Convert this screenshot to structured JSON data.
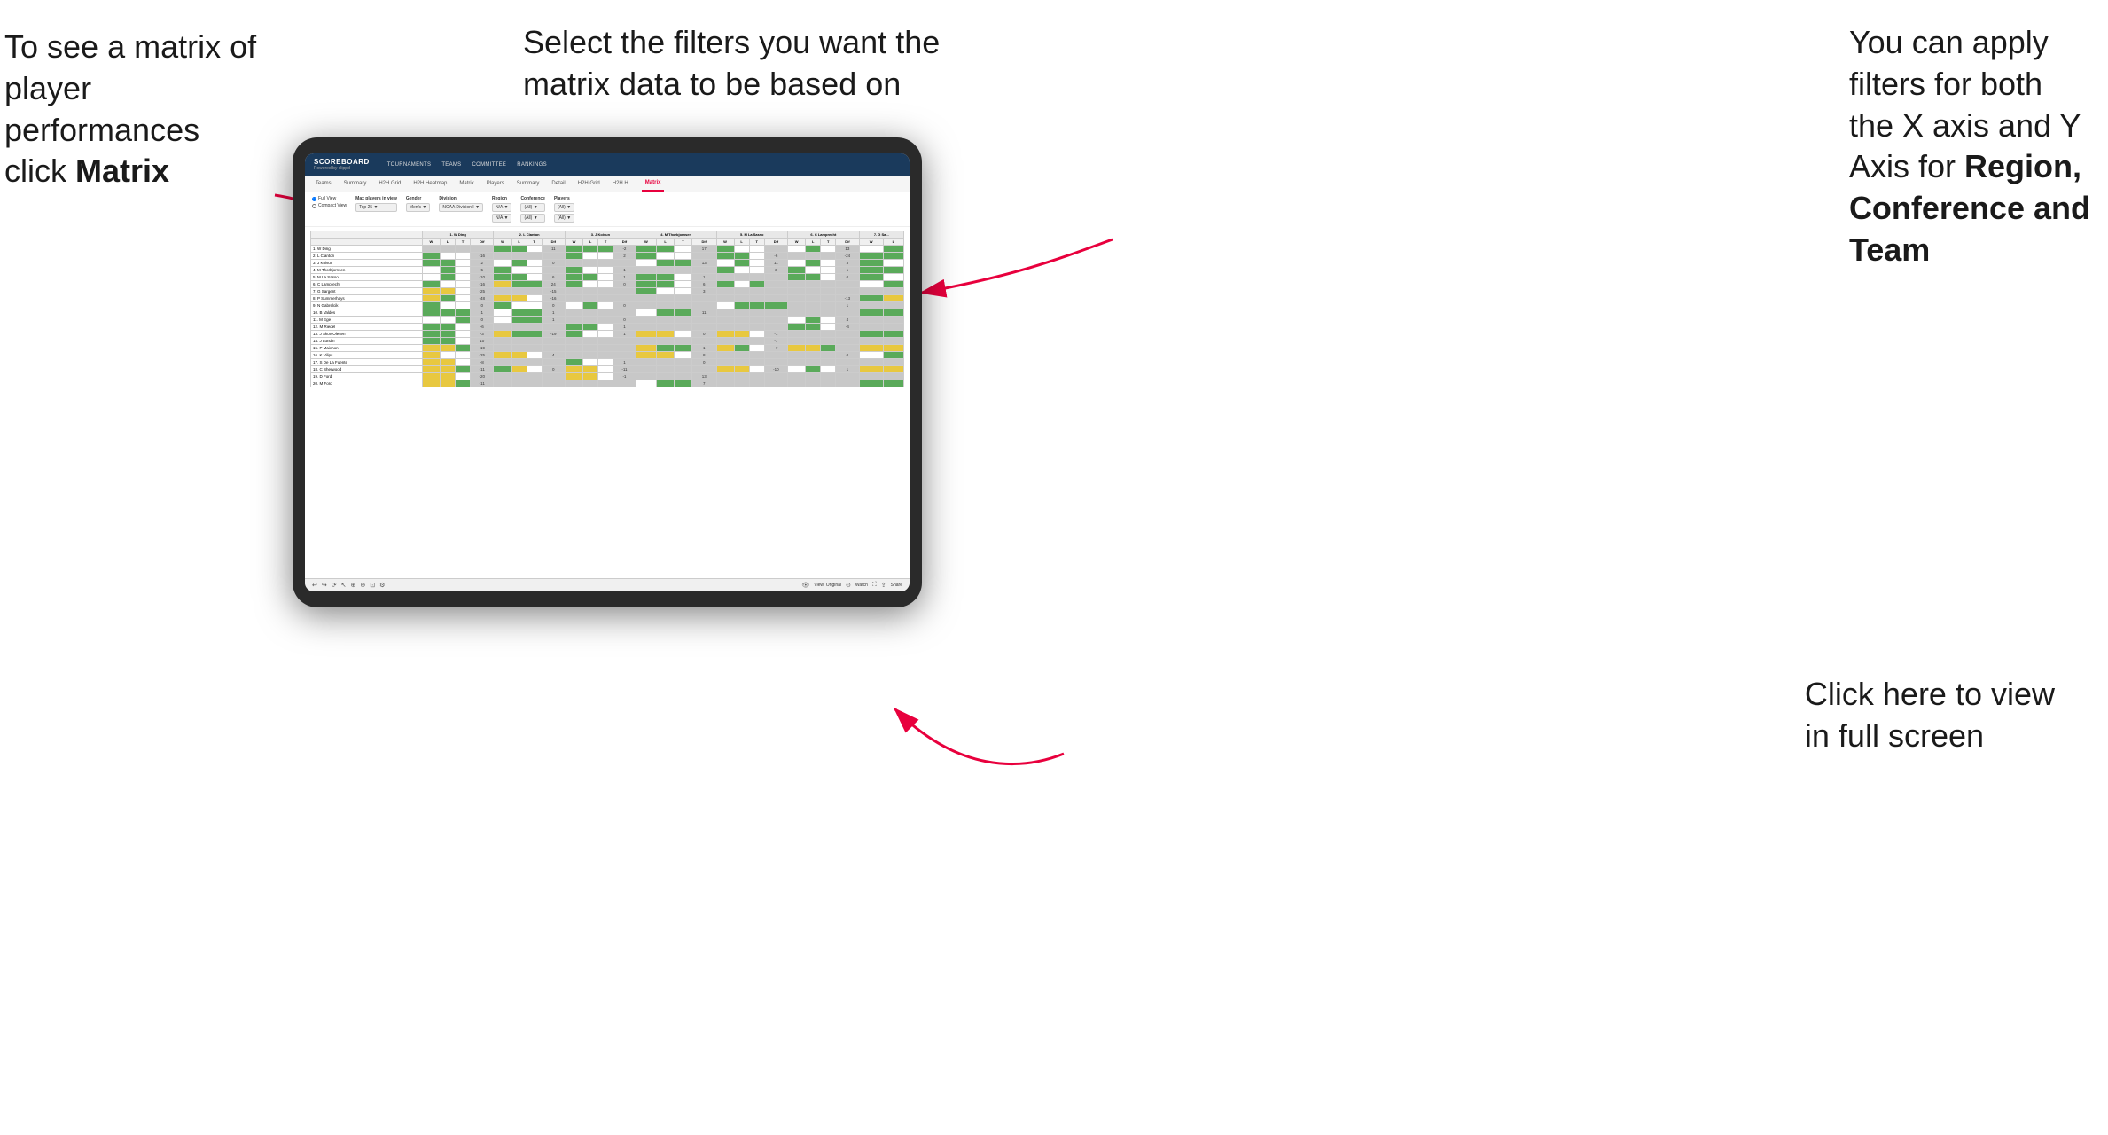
{
  "annotations": {
    "top_left": {
      "line1": "To see a matrix of",
      "line2": "player performances",
      "line3_prefix": "click ",
      "line3_bold": "Matrix"
    },
    "top_center": {
      "line1": "Select the filters you want the",
      "line2": "matrix data to be based on"
    },
    "top_right": {
      "line1": "You  can apply",
      "line2": "filters for both",
      "line3": "the X axis and Y",
      "line4_prefix": "Axis for ",
      "line4_bold": "Region,",
      "line5_bold": "Conference and",
      "line6_bold": "Team"
    },
    "bottom_right": {
      "line1": "Click here to view",
      "line2": "in full screen"
    }
  },
  "nav": {
    "logo_main": "SCOREBOARD",
    "logo_sub": "Powered by clippd",
    "items": [
      "TOURNAMENTS",
      "TEAMS",
      "COMMITTEE",
      "RANKINGS"
    ]
  },
  "sub_tabs": [
    {
      "label": "Teams",
      "active": false
    },
    {
      "label": "Summary",
      "active": false
    },
    {
      "label": "H2H Grid",
      "active": false
    },
    {
      "label": "H2H Heatmap",
      "active": false
    },
    {
      "label": "Matrix",
      "active": false
    },
    {
      "label": "Players",
      "active": false
    },
    {
      "label": "Summary",
      "active": false
    },
    {
      "label": "Detail",
      "active": false
    },
    {
      "label": "H2H Grid",
      "active": false
    },
    {
      "label": "H2H H...",
      "active": false
    },
    {
      "label": "Matrix",
      "active": true
    }
  ],
  "filters": {
    "view_options": [
      "Full View",
      "Compact View"
    ],
    "max_players": {
      "label": "Max players in view",
      "value": "Top 25"
    },
    "gender": {
      "label": "Gender",
      "value": "Men's"
    },
    "division": {
      "label": "Division",
      "value": "NCAA Division I"
    },
    "region": {
      "label": "Region",
      "values": [
        "N/A",
        "N/A"
      ]
    },
    "conference": {
      "label": "Conference",
      "values": [
        "(All)",
        "(All)"
      ]
    },
    "players": {
      "label": "Players",
      "values": [
        "(All)",
        "(All)"
      ]
    }
  },
  "players": [
    "1. W Ding",
    "2. L Clanton",
    "3. J Koivun",
    "4. M Thorbjornsen",
    "5. M La Sasso",
    "6. C Lamprecht",
    "7. G Sargent",
    "8. P Summerhays",
    "9. N Gabrelcik",
    "10. B Valdes",
    "11. M Ege",
    "12. M Riedel",
    "13. J Skov Olesen",
    "14. J Lundin",
    "15. P Maichon",
    "16. K Vilips",
    "17. S De La Fuente",
    "18. C Sherwood",
    "19. D Ford",
    "20. M Ford"
  ],
  "col_headers": [
    "1. W Ding",
    "2. L Clanton",
    "3. J Koivun",
    "4. M Thorbjornsen",
    "5. M La Sasso",
    "6. C Lamprecht",
    "7. G Sa..."
  ],
  "sub_col_headers": [
    "W",
    "L",
    "T",
    "Dif"
  ],
  "toolbar": {
    "view_label": "View: Original",
    "watch_label": "Watch",
    "share_label": "Share"
  }
}
